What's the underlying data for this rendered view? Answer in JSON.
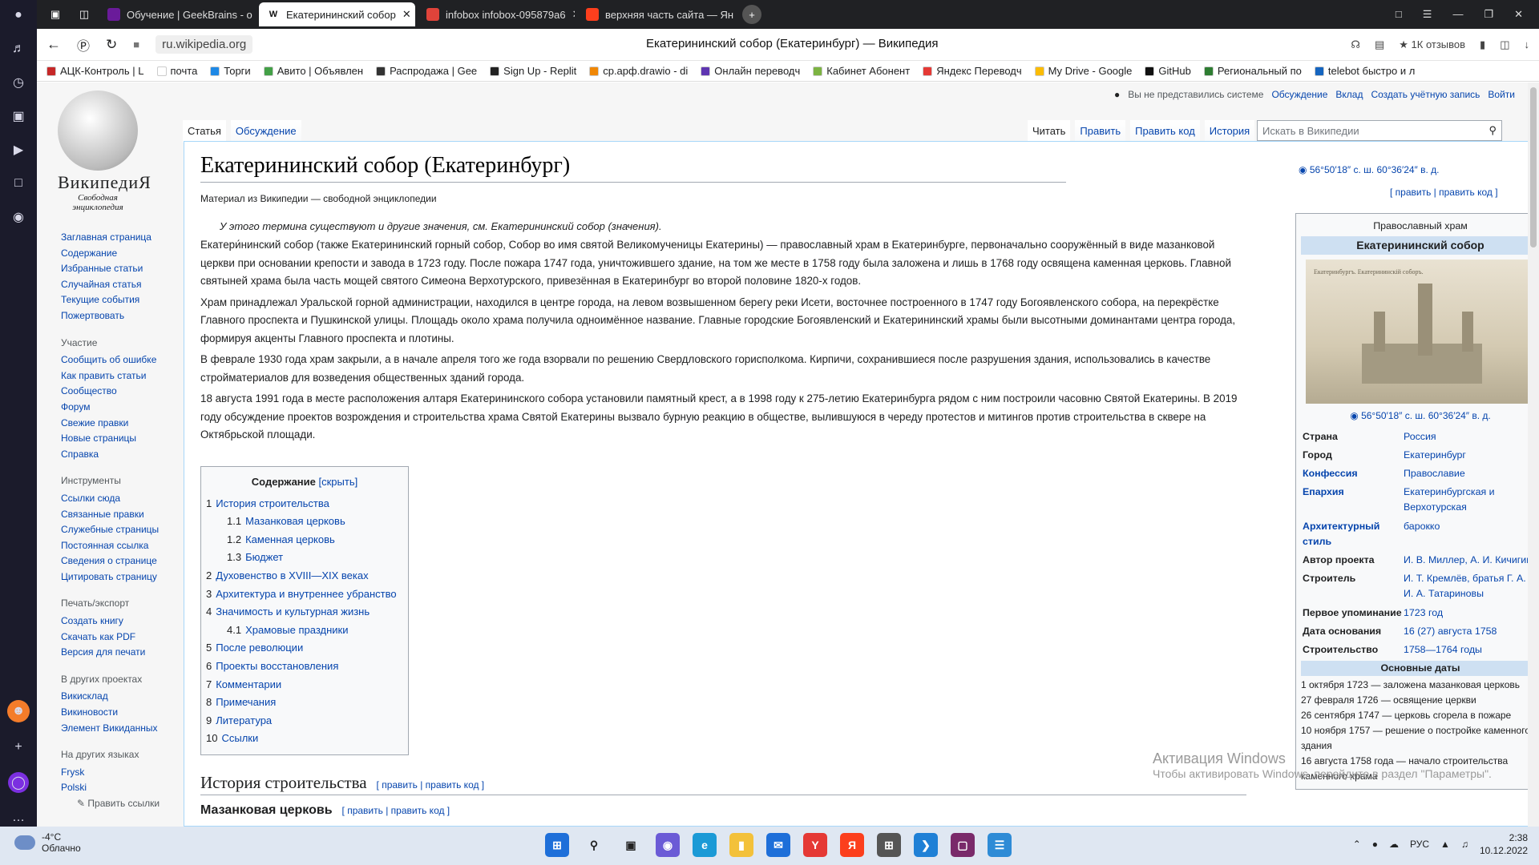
{
  "browser": {
    "tabs": [
      {
        "label": "Обучение | GeekBrains - о",
        "icon": "gb-icon",
        "color": "#6a1b9a"
      },
      {
        "label": "Екатерининский собор",
        "icon": "wikipedia-icon",
        "color": "#ffffff"
      },
      {
        "label": "infobox infobox-095879a6",
        "icon": "pen-icon",
        "color": "#e0433a"
      },
      {
        "label": "верхняя часть сайта — Ян",
        "icon": "yandex-icon",
        "color": "#fc3f1d"
      }
    ],
    "url": "ru.wikipedia.org",
    "page_title": "Екатерининский собор (Екатеринбург) — Википедия",
    "reviews": "1К отзывов",
    "bookmarks": [
      {
        "label": "АЦК-Контроль | L",
        "color": "#c62828"
      },
      {
        "label": "почта",
        "color": "#ffffff"
      },
      {
        "label": "Торги",
        "color": "#1e88e5"
      },
      {
        "label": "Авито | Объявлен",
        "color": "#43a047"
      },
      {
        "label": "Распродажа | Gee",
        "color": "#333333"
      },
      {
        "label": "Sign Up - Replit",
        "color": "#222222"
      },
      {
        "label": "ср.арф.drawio - di",
        "color": "#f08705"
      },
      {
        "label": "Онлайн переводч",
        "color": "#5e35b1"
      },
      {
        "label": "Кабинет Абонент",
        "color": "#7cb342"
      },
      {
        "label": "Яндекс Переводч",
        "color": "#e53935"
      },
      {
        "label": "My Drive - Google",
        "color": "#fbbc04"
      },
      {
        "label": "GitHub",
        "color": "#111111"
      },
      {
        "label": "Региональный по",
        "color": "#2e7d32"
      },
      {
        "label": "telebot быстро и л",
        "color": "#1565c0"
      }
    ]
  },
  "wiki": {
    "logo_name": "ВикипедиЯ",
    "logo_sub": "Свободная энциклопедия",
    "user_tools": [
      "Обсуждение",
      "Вклад",
      "Создать учётную запись",
      "Войти"
    ],
    "not_logged": "Вы не представились системе",
    "tabs_left": [
      "Статья",
      "Обсуждение"
    ],
    "tabs_right": [
      "Читать",
      "Править",
      "Править код",
      "История"
    ],
    "search_placeholder": "Искать в Википедии",
    "sidebar": [
      {
        "header": "",
        "items": [
          "Заглавная страница",
          "Содержание",
          "Избранные статьи",
          "Случайная статья",
          "Текущие события",
          "Пожертвовать"
        ]
      },
      {
        "header": "Участие",
        "items": [
          "Сообщить об ошибке",
          "Как править статьи",
          "Сообщество",
          "Форум",
          "Свежие правки",
          "Новые страницы",
          "Справка"
        ]
      },
      {
        "header": "Инструменты",
        "items": [
          "Ссылки сюда",
          "Связанные правки",
          "Служебные страницы",
          "Постоянная ссылка",
          "Сведения о странице",
          "Цитировать страницу"
        ]
      },
      {
        "header": "Печать/экспорт",
        "items": [
          "Создать книгу",
          "Скачать как PDF",
          "Версия для печати"
        ]
      },
      {
        "header": "В других проектах",
        "items": [
          "Викисклад",
          "Викиновости",
          "Элемент Викиданных"
        ]
      },
      {
        "header": "На других языках",
        "items": [
          "Frysk",
          "Polski"
        ]
      }
    ],
    "edit_links": "Править ссылки",
    "title": "Екатерининский собор (Екатеринбург)",
    "coords": "56°50′18″ с. ш. 60°36′24″ в. д.",
    "site_sub": "Материал из Википедии — свободной энциклопедии",
    "edit_top": "[ править | править код ]",
    "hatnote": "У этого термина существуют и другие значения, см. Екатерининский собор (значения).",
    "paragraphs": [
      "Екатери́нинский собор (также Екатерининский горный собор, Собор во имя святой Великомученицы Екатерины) — православный храм в Екатеринбурге, первоначально сооружённый в виде мазанковой церкви при основании крепости и завода в 1723 году. После пожара 1747 года, уничтожившего здание, на том же месте в 1758 году была заложена и лишь в 1768 году освящена каменная церковь. Главной святыней храма была часть мощей святого Симеона Верхотурского, привезённая в Екатеринбург во второй половине 1820-х годов.",
      "Храм принадлежал Уральской горной администрации, находился в центре города, на левом возвышенном берегу реки Исети, восточнее построенного в 1747 году Богоявленского собора, на перекрёстке Главного проспекта и Пушкинской улицы. Площадь около храма получила одноимённое название. Главные городские Богоявленский и Екатерининский храмы были высотными доминантами центра города, формируя акценты Главного проспекта и плотины.",
      "В феврале 1930 года храм закрыли, а в начале апреля того же года взорвали по решению Свердловского горисполкома. Кирпичи, сохранившиеся после разрушения здания, использовались в качестве стройматериалов для возведения общественных зданий города.",
      "18 августа 1991 года в месте расположения алтаря Екатерининского собора установили памятный крест, а в 1998 году к 275-летию Екатеринбурга рядом с ним построили часовню Святой Екатерины. В 2019 году обсуждение проектов возрождения и строительства храма Святой Екатерины вызвало бурную реакцию в обществе, вылившуюся в череду протестов и митингов против строительства в сквере на Октябрьской площади."
    ],
    "toc_title": "Содержание",
    "toc_hide": "[скрыть]",
    "toc": [
      {
        "n": "1",
        "t": "История строительства",
        "lvl": 1
      },
      {
        "n": "1.1",
        "t": "Мазанковая церковь",
        "lvl": 2
      },
      {
        "n": "1.2",
        "t": "Каменная церковь",
        "lvl": 2
      },
      {
        "n": "1.3",
        "t": "Бюджет",
        "lvl": 2
      },
      {
        "n": "2",
        "t": "Духовенство в XVIII—XIX веках",
        "lvl": 1
      },
      {
        "n": "3",
        "t": "Архитектура и внутреннее убранство",
        "lvl": 1
      },
      {
        "n": "4",
        "t": "Значимость и культурная жизнь",
        "lvl": 1
      },
      {
        "n": "4.1",
        "t": "Храмовые праздники",
        "lvl": 2
      },
      {
        "n": "5",
        "t": "После революции",
        "lvl": 1
      },
      {
        "n": "6",
        "t": "Проекты восстановления",
        "lvl": 1
      },
      {
        "n": "7",
        "t": "Комментарии",
        "lvl": 1
      },
      {
        "n": "8",
        "t": "Примечания",
        "lvl": 1
      },
      {
        "n": "9",
        "t": "Литература",
        "lvl": 1
      },
      {
        "n": "10",
        "t": "Ссылки",
        "lvl": 1
      }
    ],
    "h2": "История строительства",
    "h3": "Мазанковая церковь",
    "edit_sec": "[ править | править код ]",
    "infobox": {
      "type": "Православный храм",
      "title": "Екатерининский собор",
      "image_caption": "Екатеринбургъ. Екатерининскій соборъ.",
      "coords": "56°50′18″ с. ш. 60°36′24″ в. д.",
      "rows": [
        {
          "k": "Страна",
          "v": "Россия",
          "link_key": false
        },
        {
          "k": "Город",
          "v": "Екатеринбург",
          "link_key": false
        },
        {
          "k": "Конфессия",
          "v": "Православие",
          "link_key": true
        },
        {
          "k": "Епархия",
          "v": "Екатеринбургская и Верхотурская",
          "link_key": true
        },
        {
          "k": "Архитектурный стиль",
          "v": "барокко",
          "link_key": true
        },
        {
          "k": "Автор проекта",
          "v": "И. В. Миллер, А. И. Кичигин",
          "link_key": false
        },
        {
          "k": "Строитель",
          "v": "И. Т. Кремлёв, братья Г. А. и И. А. Татариновы",
          "link_key": false
        },
        {
          "k": "Первое упоминание",
          "v": "1723 год",
          "link_key": false
        },
        {
          "k": "Дата основания",
          "v": "16 (27) августа 1758",
          "link_key": false
        },
        {
          "k": "Строительство",
          "v": "1758—1764 годы",
          "link_key": false
        }
      ],
      "dates_title": "Основные даты",
      "dates": [
        "1 октября 1723 — заложена мазанковая церковь",
        "27 февраля 1726 — освящение церкви",
        "26 сентября 1747 — церковь сгорела в пожаре",
        "10 ноября 1757 — решение о постройке каменного здания",
        "16 августа 1758 года — начало строительства каменного храма"
      ]
    }
  },
  "activation": {
    "title": "Активация Windows",
    "sub": "Чтобы активировать Windows, перейдите в раздел \"Параметры\"."
  },
  "taskbar": {
    "temp": "-4°C",
    "weather": "Облачно",
    "lang": "РУС",
    "time": "2:38",
    "date": "10.12.2022"
  }
}
